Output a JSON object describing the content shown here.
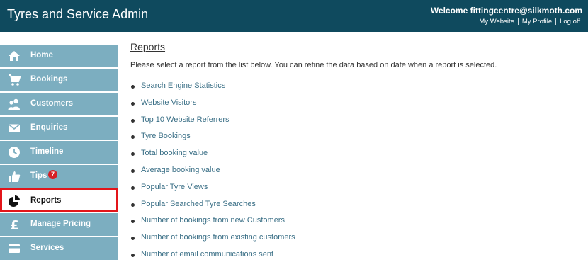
{
  "header": {
    "app_title": "Tyres and Service Admin",
    "welcome": "Welcome fittingcentre@silkmoth.com",
    "links": [
      "My Website",
      "My Profile",
      "Log off"
    ]
  },
  "sidebar": {
    "items": [
      {
        "label": "Home",
        "icon": "home-icon"
      },
      {
        "label": "Bookings",
        "icon": "cart-icon"
      },
      {
        "label": "Customers",
        "icon": "users-icon"
      },
      {
        "label": "Enquiries",
        "icon": "envelope-icon"
      },
      {
        "label": "Timeline",
        "icon": "clock-icon"
      },
      {
        "label": "Tips",
        "icon": "thumbs-up-icon",
        "badge": "7"
      },
      {
        "label": "Reports",
        "icon": "pie-chart-icon",
        "active": true
      },
      {
        "label": "Manage Pricing",
        "icon": "pound-icon"
      },
      {
        "label": "Services",
        "icon": "card-icon"
      }
    ]
  },
  "main": {
    "title": "Reports",
    "intro": "Please select a report from the list below. You can refine the data based on date when a report is selected.",
    "reports": [
      "Search Engine Statistics",
      "Website Visitors",
      "Top 10 Website Referrers",
      "Tyre Bookings",
      "Total booking value",
      "Average booking value",
      "Popular Tyre Views",
      "Popular Searched Tyre Searches",
      "Number of bookings from new Customers",
      "Number of bookings from existing customers",
      "Number of email communications sent"
    ]
  },
  "colors": {
    "header_bg": "#0f4a5e",
    "sidebar_item_bg": "#7caec0",
    "active_border": "#e3151a",
    "link": "#3a6f86",
    "badge": "#d61f26"
  }
}
